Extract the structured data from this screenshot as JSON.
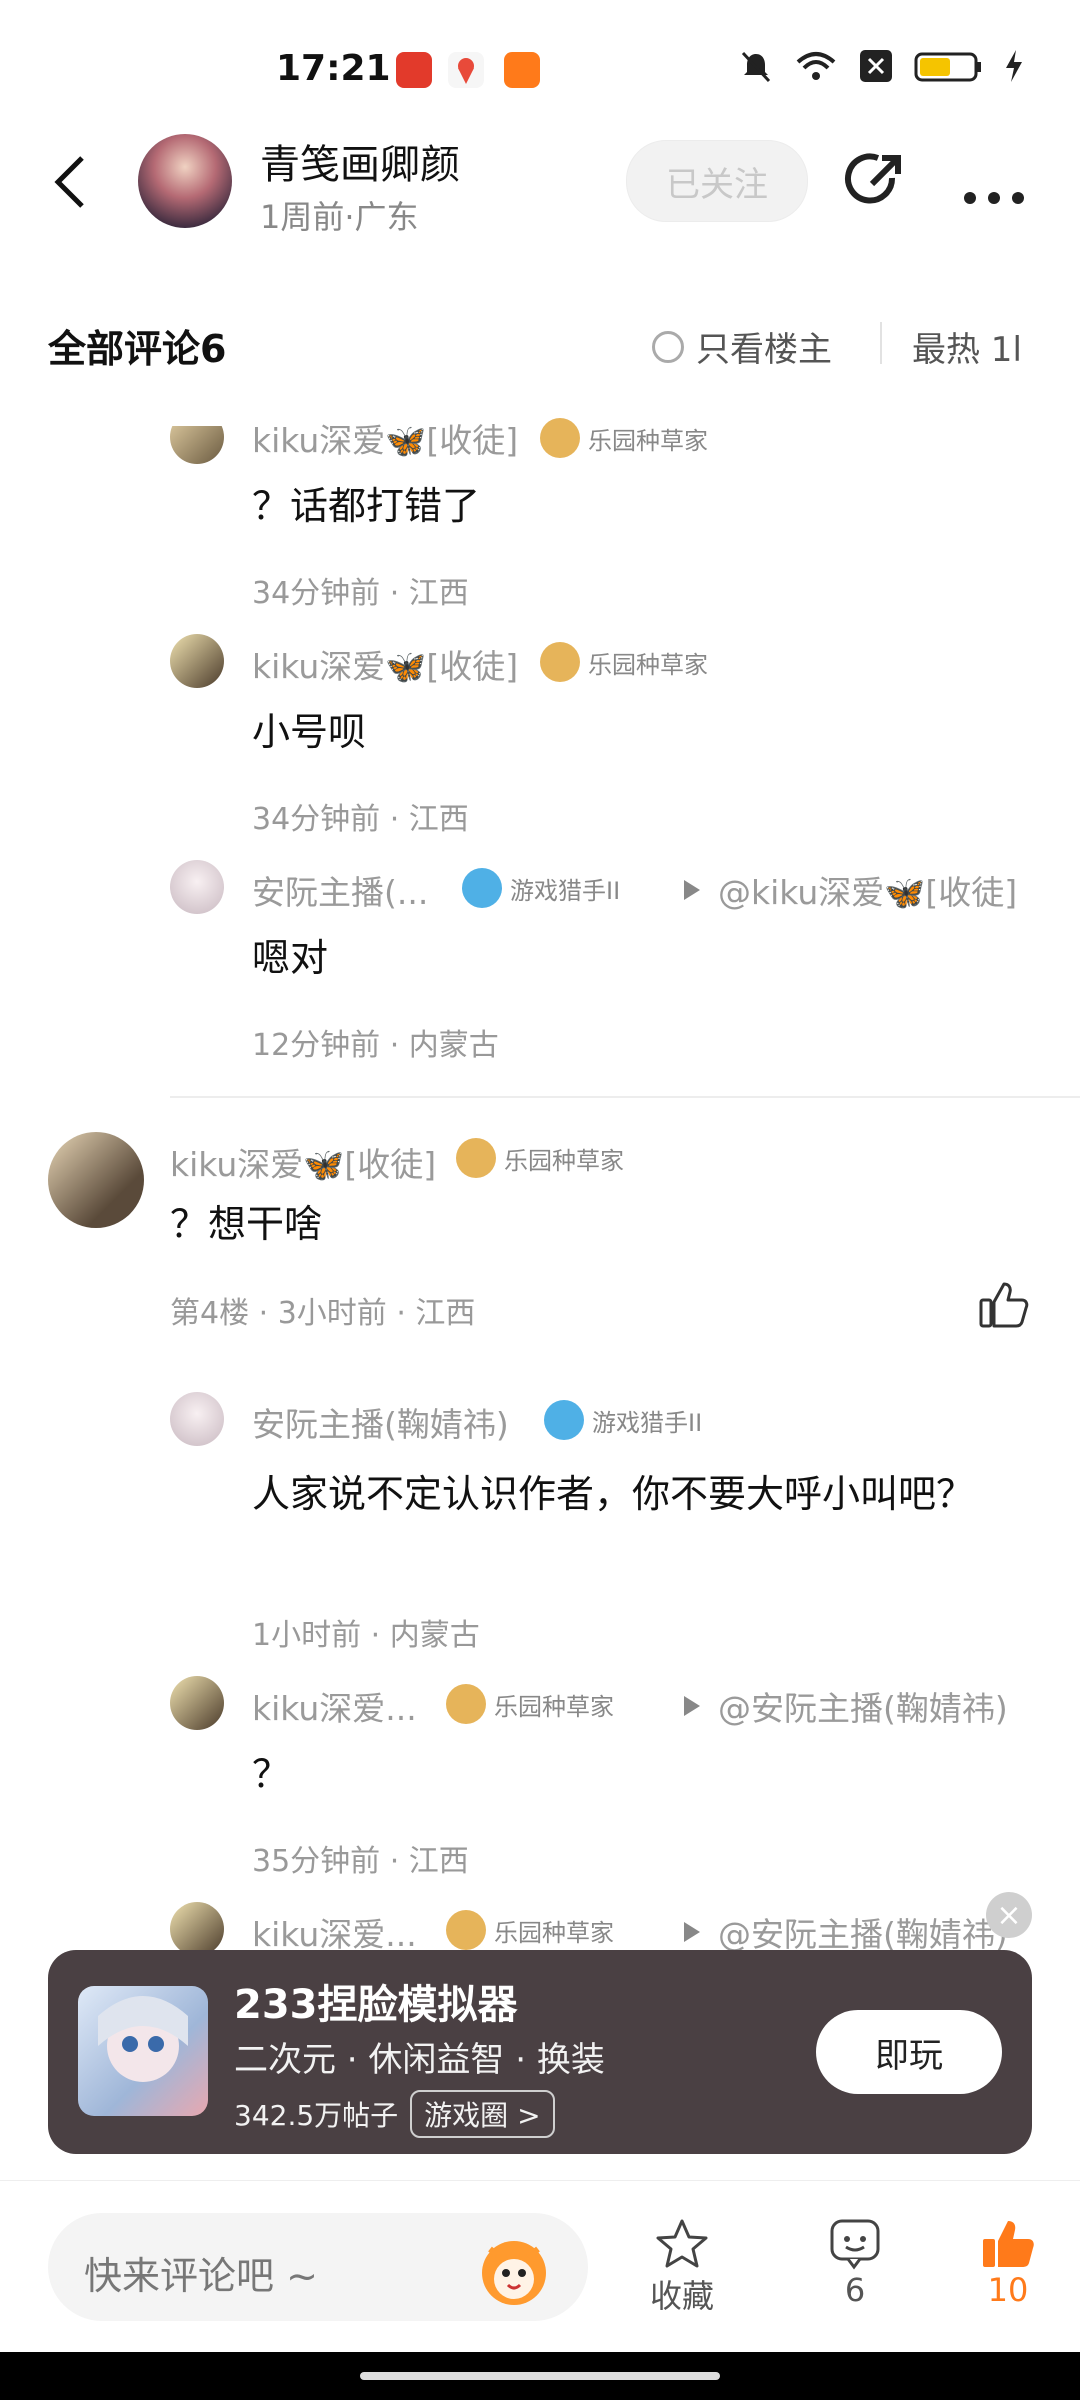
{
  "status_bar": {
    "time": "17:21"
  },
  "header": {
    "author_name": "青笺画卿颜",
    "author_meta": "1周前·广东",
    "follow_label": "已关注"
  },
  "comments_header": {
    "title": "全部评论6",
    "only_owner": "只看楼主",
    "sort": "最热 1l"
  },
  "replies_top": [
    {
      "user": "kiku深爱🦋[收徒]",
      "badge": "乐园种草家",
      "text": "？话都打错了",
      "meta": "34分钟前 · 江西"
    },
    {
      "user": "kiku深爱🦋[收徒]",
      "badge": "乐园种草家",
      "text": "小号呗",
      "meta": "34分钟前 · 江西"
    },
    {
      "user": "安阮主播(...",
      "badge": "游戏猎手II",
      "reply_to": "@kiku深爱🦋[收徒]",
      "text": "嗯对",
      "meta": "12分钟前 · 内蒙古"
    }
  ],
  "floor4": {
    "user": "kiku深爱🦋[收徒]",
    "badge": "乐园种草家",
    "text": "？想干啥",
    "meta": "第4楼 · 3小时前 · 江西"
  },
  "replies_floor4": [
    {
      "user": "安阮主播(鞠婧祎)",
      "badge": "游戏猎手II",
      "text": "人家说不定认识作者，你不要大呼小叫吧？",
      "meta": "1小时前 · 内蒙古"
    },
    {
      "user": "kiku深爱...",
      "badge": "乐园种草家",
      "reply_to": "@安阮主播(鞠婧祎)",
      "text": "？",
      "meta": "35分钟前 · 江西"
    },
    {
      "user": "kiku深爱...",
      "badge": "乐园种草家",
      "reply_to": "@安阮主播(鞠婧祎)"
    }
  ],
  "ad": {
    "title": "233捏脸模拟器",
    "tags": "二次元 · 休闲益智 · 换装",
    "posts": "342.5万帖子",
    "circle": "游戏圈 >",
    "play": "即玩",
    "close": "×"
  },
  "bottom": {
    "placeholder": "快来评论吧 ~",
    "favorite_label": "收藏",
    "comment_count": "6",
    "like_count": "10"
  },
  "colors": {
    "accent": "#ff7a1a",
    "ad_bg": "#4a4043"
  }
}
